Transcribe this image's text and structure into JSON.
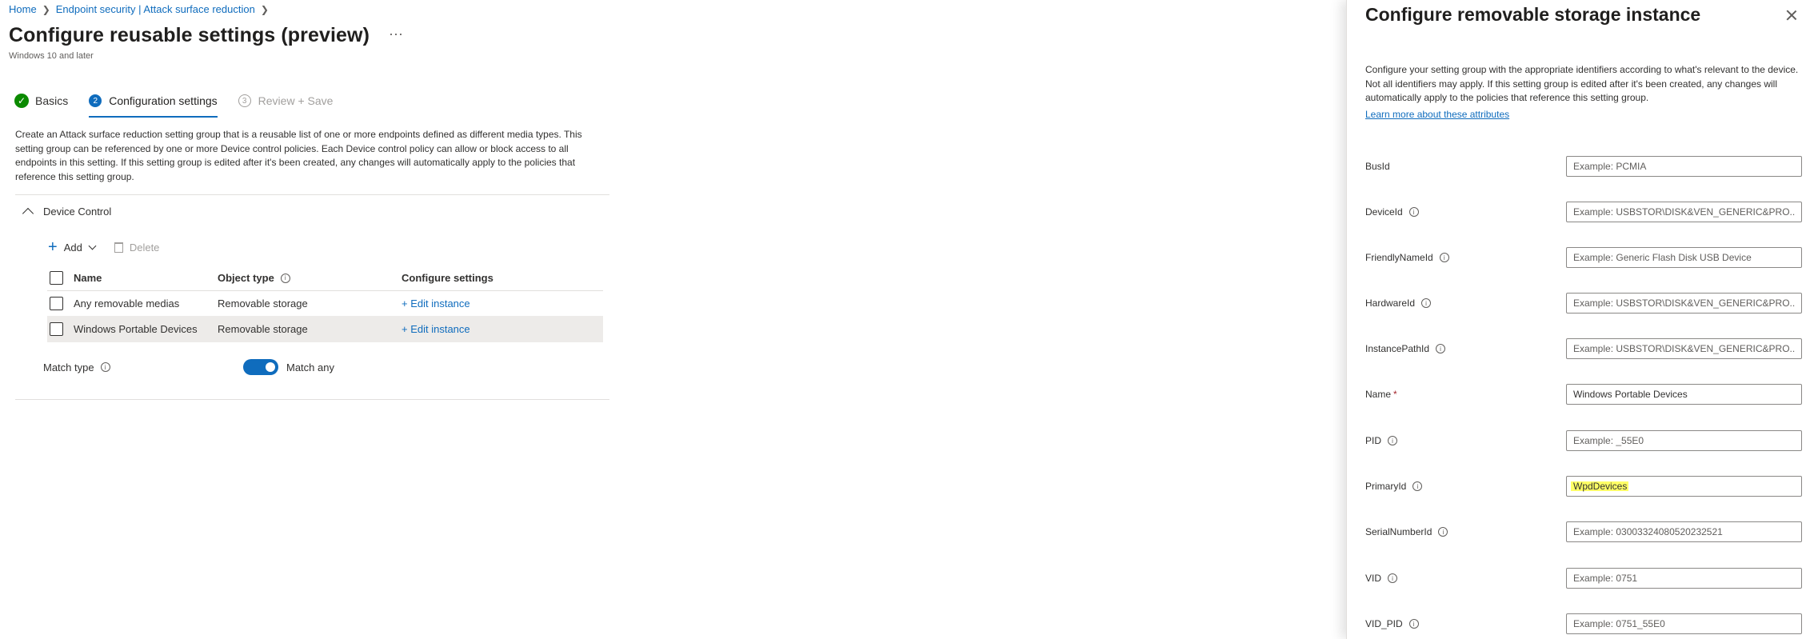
{
  "breadcrumb": {
    "home": "Home",
    "section": "Endpoint security | Attack surface reduction"
  },
  "header": {
    "title": "Configure reusable settings (preview)",
    "more": "···",
    "subtitle": "Windows 10 and later"
  },
  "steps": [
    {
      "label": "Basics",
      "state": "complete"
    },
    {
      "label": "Configuration settings",
      "number": "2",
      "state": "active"
    },
    {
      "label": "Review + Save",
      "number": "3",
      "state": "disabled"
    }
  ],
  "description": "Create an Attack surface reduction setting group that is a reusable list of one or more endpoints defined as different media types. This setting group can be referenced by one or more Device control policies. Each Device control policy can allow or block access to all endpoints in this setting. If this setting group is edited after it's been created, any changes will automatically apply to the policies that reference this setting group.",
  "section": {
    "title": "Device Control"
  },
  "toolbar": {
    "add_label": "Add",
    "delete_label": "Delete"
  },
  "table": {
    "columns": [
      "Name",
      "Object type",
      "Configure settings"
    ],
    "rows": [
      {
        "name": "Any removable medias",
        "type": "Removable storage",
        "action": "+ Edit instance"
      },
      {
        "name": "Windows Portable Devices",
        "type": "Removable storage",
        "action": "+ Edit instance"
      }
    ]
  },
  "match": {
    "label": "Match type",
    "value": "Match any",
    "enabled": true
  },
  "panel": {
    "title": "Configure removable storage instance",
    "description": "Configure your setting group with the appropriate identifiers according to what's relevant to the device. Not all identifiers may apply. If this setting group is edited after it's been created, any changes will automatically apply to the policies that reference this setting group.",
    "link": "Learn more about these attributes",
    "fields": [
      {
        "label": "BusId",
        "info": false,
        "placeholder": "Example: PCMIA",
        "value": ""
      },
      {
        "label": "DeviceId",
        "info": true,
        "placeholder": "Example: USBSTOR\\DISK&VEN_GENERIC&PRO...",
        "value": ""
      },
      {
        "label": "FriendlyNameId",
        "info": true,
        "placeholder": "Example: Generic Flash Disk USB Device",
        "value": ""
      },
      {
        "label": "HardwareId",
        "info": true,
        "placeholder": "Example: USBSTOR\\DISK&VEN_GENERIC&PRO...",
        "value": ""
      },
      {
        "label": "InstancePathId",
        "info": true,
        "placeholder": "Example: USBSTOR\\DISK&VEN_GENERIC&PRO...",
        "value": ""
      },
      {
        "label": "Name",
        "required": "*",
        "info": false,
        "placeholder": "",
        "value": "Windows Portable Devices"
      },
      {
        "label": "PID",
        "info": true,
        "placeholder": "Example: _55E0",
        "value": ""
      },
      {
        "label": "PrimaryId",
        "info": true,
        "placeholder": "",
        "value": "WpdDevices"
      },
      {
        "label": "SerialNumberId",
        "info": true,
        "placeholder": "Example: 03003324080520232521",
        "value": ""
      },
      {
        "label": "VID",
        "info": true,
        "placeholder": "Example: 0751",
        "value": ""
      },
      {
        "label": "VID_PID",
        "info": true,
        "placeholder": "Example: 0751_55E0",
        "value": ""
      }
    ]
  },
  "colors": {
    "accent": "#0f6cbd",
    "success": "#0b8a00",
    "highlight": "#ffff66"
  }
}
